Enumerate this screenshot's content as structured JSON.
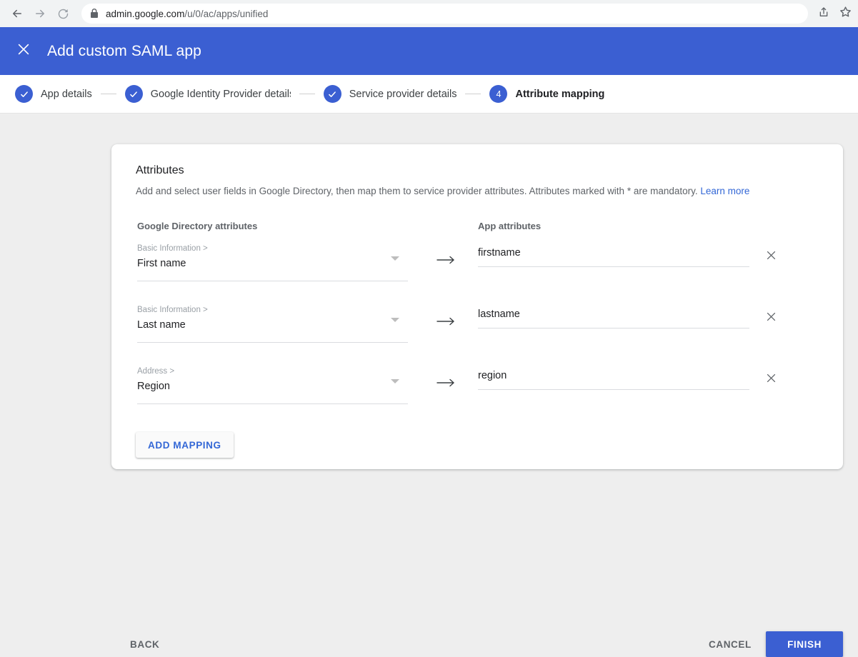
{
  "browser": {
    "back_icon": "back-arrow-icon",
    "forward_icon": "forward-arrow-icon",
    "reload_icon": "reload-icon",
    "lock_icon": "lock-icon",
    "url_domain": "admin.google.com",
    "url_path": "/u/0/ac/apps/unified",
    "share_icon": "share-icon",
    "bookmark_icon": "star-icon"
  },
  "header": {
    "close_icon": "close-icon",
    "title": "Add custom SAML app",
    "background_color": "#3b5fd2"
  },
  "stepper": {
    "steps": [
      {
        "label": "App details",
        "state": "complete",
        "marker": "check"
      },
      {
        "label": "Google Identity Provider details",
        "state": "complete",
        "marker": "check"
      },
      {
        "label": "Service provider details",
        "state": "complete",
        "marker": "check"
      },
      {
        "label": "Attribute mapping",
        "state": "active",
        "marker": "4"
      }
    ]
  },
  "card": {
    "title": "Attributes",
    "description": "Add and select user fields in Google Directory, then map them to service provider attributes. Attributes marked with * are mandatory.",
    "learn_more_label": "Learn more",
    "column_headers": {
      "left": "Google Directory attributes",
      "right": "App attributes"
    },
    "mappings": [
      {
        "directory_category": "Basic Information >",
        "directory_field": "First name",
        "arrow_icon": "right-arrow-icon",
        "app_attribute": "firstname",
        "app_attribute_placeholder": "",
        "remove_icon": "close-icon"
      },
      {
        "directory_category": "Basic Information >",
        "directory_field": "Last name",
        "arrow_icon": "right-arrow-icon",
        "app_attribute": "lastname",
        "app_attribute_placeholder": "",
        "remove_icon": "close-icon"
      },
      {
        "directory_category": "Address >",
        "directory_field": "Region",
        "arrow_icon": "right-arrow-icon",
        "app_attribute": "region",
        "app_attribute_placeholder": "",
        "remove_icon": "close-icon"
      }
    ],
    "add_mapping_label": "ADD MAPPING"
  },
  "footer": {
    "back_label": "BACK",
    "cancel_label": "CANCEL",
    "finish_label": "FINISH",
    "finish_color": "#3b5fd2"
  }
}
